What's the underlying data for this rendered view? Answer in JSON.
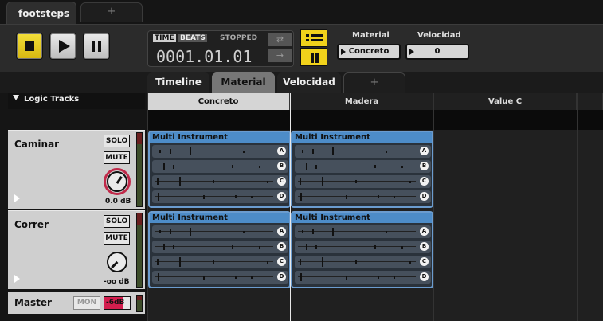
{
  "doc_tabs": {
    "active": "footsteps",
    "add": "+"
  },
  "transport": {
    "time_tag": "TIME",
    "beats_tag": "BEATS",
    "status": "STOPPED",
    "counter": "0001.01.01",
    "loop_a": "⇄",
    "loop_b": "→"
  },
  "params": [
    {
      "label": "Material",
      "value": "Concreto"
    },
    {
      "label": "Velocidad",
      "value": "0"
    }
  ],
  "section_tabs": [
    "Timeline",
    "Material",
    "Velocidad",
    "+"
  ],
  "logic_tracks_label": "Logic Tracks",
  "columns": [
    "Concreto",
    "Madera",
    "Value C"
  ],
  "tracks": [
    {
      "name": "Caminar",
      "solo": "SOLO",
      "mute": "MUTE",
      "volume": "0.0 dB"
    },
    {
      "name": "Correr",
      "solo": "SOLO",
      "mute": "MUTE",
      "volume": "-oo dB"
    }
  ],
  "master": {
    "name": "Master",
    "mon": "MON",
    "volume": "-6dB"
  },
  "clip_title": "Multi Instrument",
  "lanes": [
    "A",
    "B",
    "C",
    "D"
  ],
  "colors": {
    "accent_yellow": "#f1d21b",
    "clip_blue": "#4d8cc8",
    "knob_red": "#c02a4a"
  }
}
